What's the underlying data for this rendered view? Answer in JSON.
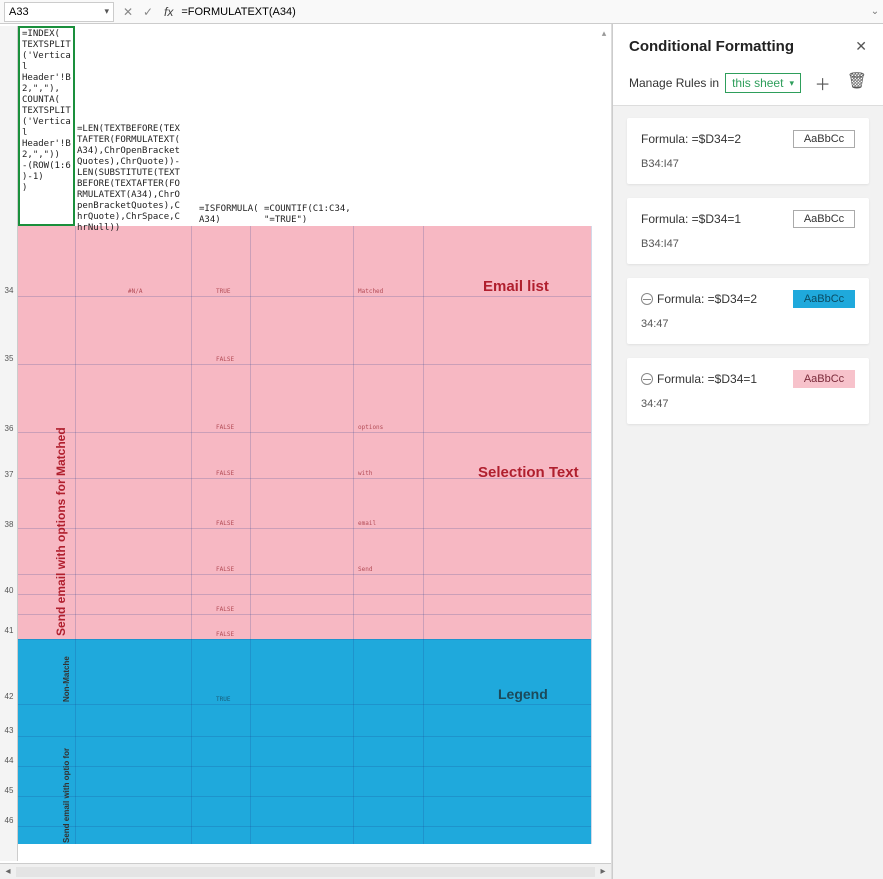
{
  "formula_bar": {
    "name_box": "A33",
    "fx_label": "fx",
    "formula": "=FORMULATEXT(A34)"
  },
  "cf": {
    "title": "Conditional Formatting",
    "manage_label": "Manage Rules in",
    "scope": "this sheet",
    "rules": [
      {
        "formula": "Formula: =$D34=2",
        "range": "B34:I47",
        "sample": "AaBbCc",
        "fill": "none",
        "stop": false
      },
      {
        "formula": "Formula: =$D34=1",
        "range": "B34:I47",
        "sample": "AaBbCc",
        "fill": "none",
        "stop": false
      },
      {
        "formula": "Formula: =$D34=2",
        "range": "34:47",
        "sample": "AaBbCc",
        "fill": "blue",
        "stop": true
      },
      {
        "formula": "Formula: =$D34=1",
        "range": "34:47",
        "sample": "AaBbCc",
        "fill": "pink",
        "stop": true
      }
    ]
  },
  "cells": {
    "a33": "=INDEX(\nTEXTSPLIT\n('Vertica\nl\nHeader'!B\n2,\",\"),\nCOUNTA(\nTEXTSPLIT\n('Vertica\nl\nHeader'!B\n2,\",\"))\n-(ROW(1:6\n)-1)\n)",
    "b33": "=LEN(TEXTBEFORE(TEX\nTAFTER(FORMULATEXT(\nA34),ChrOpenBracket\nQuotes),ChrQuote))-\nLEN(SUBSTITUTE(TEXT\nBEFORE(TEXTAFTER(FO\nRMULATEXT(A34),ChrO\npenBracketQuotes),C\nhrQuote),ChrSpace,C\nhrNull))",
    "c33": "=ISFORMULA(\nA34)",
    "d33": "=COUNTIF(C1:C34,\n\"=TRUE\")"
  },
  "labels": {
    "vertical_pink": "Send   email  with   options  for   Matched",
    "vertical_blue_top": "Non-Matche",
    "vertical_blue_bot": "Send  email with  optio for",
    "email_list": "Email list",
    "selection_text": "Selection Text",
    "legend": "Legend"
  },
  "row_values": {
    "r34_b": "#N/A",
    "r34_c": "TRUE",
    "r34_d": "Matched",
    "r35_c": "FALSE",
    "r36_c": "FALSE",
    "r36_d": "options",
    "r37_c": "FALSE",
    "r37_d": "with",
    "r38_c": "FALSE",
    "r38_d": "email",
    "r39_c": "FALSE",
    "r39_d": "Send",
    "r41_c": "FALSE",
    "r42_c": "TRUE"
  },
  "row_labels": [
    "34",
    "35",
    "36",
    "37",
    "38",
    "40",
    "41",
    "42",
    "43",
    "44",
    "45",
    "46"
  ]
}
